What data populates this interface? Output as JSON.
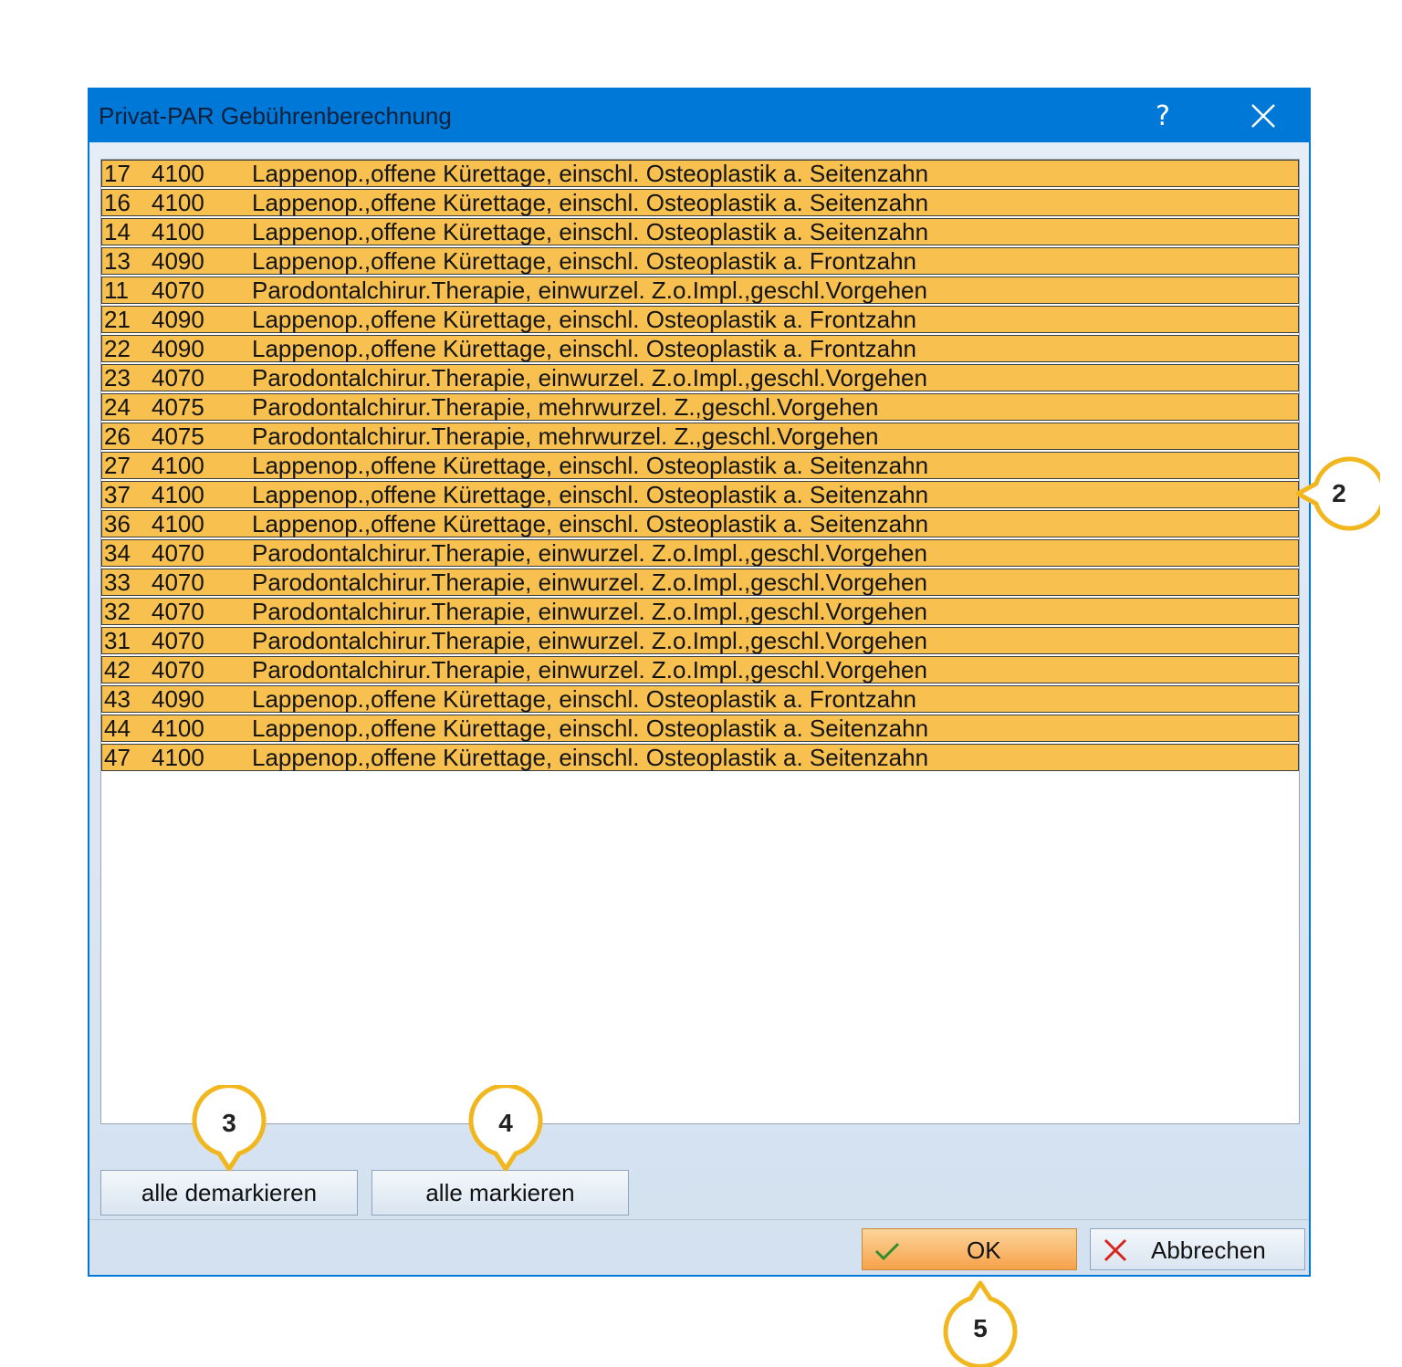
{
  "dialog": {
    "title": "Privat-PAR Gebührenberechnung",
    "help_label": "?",
    "close_icon": "close-icon"
  },
  "list": {
    "rows": [
      {
        "tooth": "17",
        "code": "4100",
        "desc": "Lappenop.,offene Kürettage, einschl. Osteoplastik a. Seitenzahn"
      },
      {
        "tooth": "16",
        "code": "4100",
        "desc": "Lappenop.,offene Kürettage, einschl. Osteoplastik a. Seitenzahn"
      },
      {
        "tooth": "14",
        "code": "4100",
        "desc": "Lappenop.,offene Kürettage, einschl. Osteoplastik a. Seitenzahn"
      },
      {
        "tooth": "13",
        "code": "4090",
        "desc": "Lappenop.,offene Kürettage, einschl. Osteoplastik a. Frontzahn"
      },
      {
        "tooth": "11",
        "code": "4070",
        "desc": "Parodontalchirur.Therapie, einwurzel. Z.o.Impl.,geschl.Vorgehen"
      },
      {
        "tooth": "21",
        "code": "4090",
        "desc": "Lappenop.,offene Kürettage, einschl. Osteoplastik a. Frontzahn"
      },
      {
        "tooth": "22",
        "code": "4090",
        "desc": "Lappenop.,offene Kürettage, einschl. Osteoplastik a. Frontzahn"
      },
      {
        "tooth": "23",
        "code": "4070",
        "desc": "Parodontalchirur.Therapie, einwurzel. Z.o.Impl.,geschl.Vorgehen"
      },
      {
        "tooth": "24",
        "code": "4075",
        "desc": "Parodontalchirur.Therapie, mehrwurzel. Z.,geschl.Vorgehen"
      },
      {
        "tooth": "26",
        "code": "4075",
        "desc": "Parodontalchirur.Therapie, mehrwurzel. Z.,geschl.Vorgehen"
      },
      {
        "tooth": "27",
        "code": "4100",
        "desc": "Lappenop.,offene Kürettage, einschl. Osteoplastik a. Seitenzahn"
      },
      {
        "tooth": "37",
        "code": "4100",
        "desc": "Lappenop.,offene Kürettage, einschl. Osteoplastik a. Seitenzahn"
      },
      {
        "tooth": "36",
        "code": "4100",
        "desc": "Lappenop.,offene Kürettage, einschl. Osteoplastik a. Seitenzahn"
      },
      {
        "tooth": "34",
        "code": "4070",
        "desc": "Parodontalchirur.Therapie, einwurzel. Z.o.Impl.,geschl.Vorgehen"
      },
      {
        "tooth": "33",
        "code": "4070",
        "desc": "Parodontalchirur.Therapie, einwurzel. Z.o.Impl.,geschl.Vorgehen"
      },
      {
        "tooth": "32",
        "code": "4070",
        "desc": "Parodontalchirur.Therapie, einwurzel. Z.o.Impl.,geschl.Vorgehen"
      },
      {
        "tooth": "31",
        "code": "4070",
        "desc": "Parodontalchirur.Therapie, einwurzel. Z.o.Impl.,geschl.Vorgehen"
      },
      {
        "tooth": "42",
        "code": "4070",
        "desc": "Parodontalchirur.Therapie, einwurzel. Z.o.Impl.,geschl.Vorgehen"
      },
      {
        "tooth": "43",
        "code": "4090",
        "desc": "Lappenop.,offene Kürettage, einschl. Osteoplastik a. Frontzahn"
      },
      {
        "tooth": "44",
        "code": "4100",
        "desc": "Lappenop.,offene Kürettage, einschl. Osteoplastik a. Seitenzahn"
      },
      {
        "tooth": "47",
        "code": "4100",
        "desc": "Lappenop.,offene Kürettage, einschl. Osteoplastik a. Seitenzahn"
      }
    ]
  },
  "buttons": {
    "demark_all": "alle demarkieren",
    "mark_all": "alle markieren",
    "ok": "OK",
    "ok_icon": "checkmark-icon",
    "cancel": "Abbrechen",
    "cancel_icon": "x-icon"
  },
  "callouts": {
    "list": "2",
    "demark": "3",
    "mark": "4",
    "ok": "5"
  },
  "colors": {
    "titlebar": "#0078d7",
    "row_selected": "#f7c04f",
    "callout": "#f2b71f",
    "ok_button": "#f6a24a"
  }
}
